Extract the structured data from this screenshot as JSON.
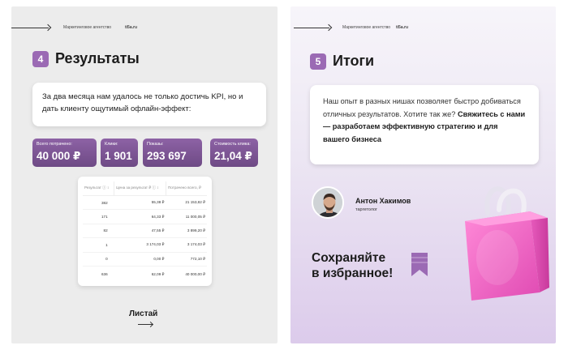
{
  "left_slide": {
    "agency": "Маркетинговое агентство",
    "site": "ti5a.ru",
    "section_number": "4",
    "section_title": "Результаты",
    "intro_text": "За два месяца нам удалось не только достичь KPI, но и дать клиенту ощутимый офлайн-эффект:",
    "metrics": [
      {
        "label": "Всего потрачено:",
        "value": "40 000 ₽"
      },
      {
        "label": "Клики:",
        "value": "1 901"
      },
      {
        "label": "Показы:",
        "value": "293 697"
      },
      {
        "label": "Стоимость клика:",
        "value": "21,04 ₽"
      }
    ],
    "table": {
      "headers": [
        "Результат ⓘ ↕",
        "Цена за результат ₽ ⓘ ↕",
        "Потрачено всего, ₽"
      ],
      "rows": [
        [
          "382",
          "55,38 ₽",
          "21 153,82 ₽"
        ],
        [
          "171",
          "64,33 ₽",
          "11 000,05 ₽"
        ],
        [
          "82",
          "47,55 ₽",
          "3 899,20 ₽"
        ],
        [
          "1",
          "3 174,03 ₽",
          "3 174,03 ₽"
        ],
        [
          "0",
          "0,00 ₽",
          "772,10 ₽"
        ]
      ],
      "total": [
        "636",
        "62,09 ₽",
        "40 000,00 ₽"
      ]
    },
    "swipe_label": "Листай"
  },
  "right_slide": {
    "agency": "Маркетинговое агентство",
    "site": "ti5a.ru",
    "section_number": "5",
    "section_title": "Итоги",
    "text_regular": "Наш опыт в разных нишах позволяет быстро добиваться отличных результатов. Хотите так же?",
    "text_cta": "Свяжитесь с нами — разработаем эффективную стратегию и для вашего бизнеса",
    "author_name": "Антон Хакимов",
    "author_role": "таргетолог",
    "save_text_line1": "Сохраняйте",
    "save_text_line2": "в избранное!"
  },
  "colors": {
    "accent": "#9b6ab4",
    "metric_bg": "#7a5392",
    "bag_pink": "#f06bc4",
    "left_bg": "#ececec"
  },
  "icons": [
    "arrow-right-icon",
    "bookmark-icon",
    "shopping-bag-icon"
  ]
}
